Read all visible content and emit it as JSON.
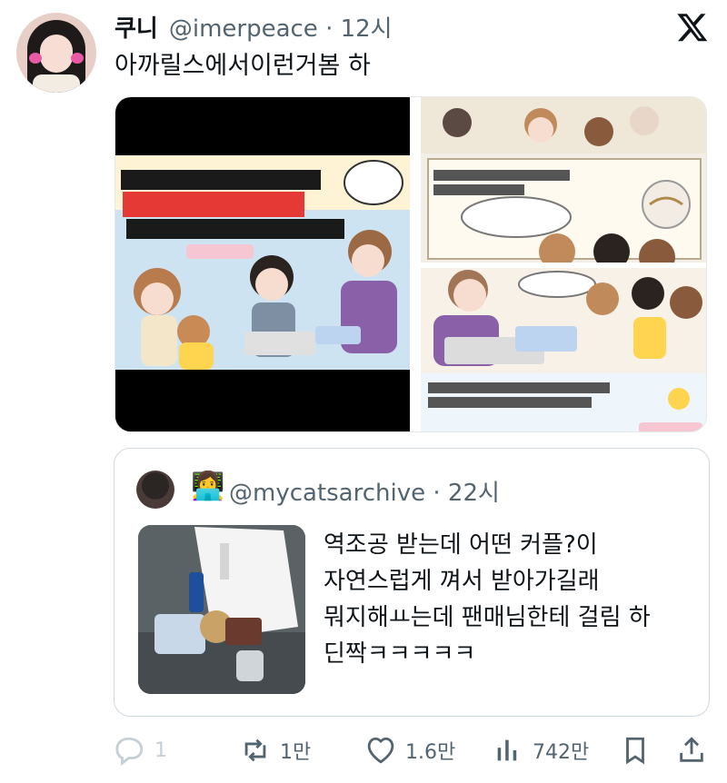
{
  "tweet": {
    "display_name": "쿠니",
    "handle": "@imerpeace · 12시",
    "text": "아까릴스에서이런거봄 하"
  },
  "quote": {
    "handle": "@mycatsarchive · 22시",
    "text": "역조공 받는데 어떤 커플?이 자연스럽게 껴서 받아가길래 뭐지해ㅛ는데 팬매님한테 걸림 하 딘짝ㅋㅋㅋㅋㅋ"
  },
  "actions": {
    "reply_count": "1",
    "retweet_count": "1만",
    "like_count": "1.6만",
    "view_count": "742만"
  },
  "icons": {
    "x_logo": "x-logo-icon",
    "reply": "reply-icon",
    "retweet": "retweet-icon",
    "like": "heart-icon",
    "views": "views-icon",
    "bookmark": "bookmark-icon",
    "share": "share-icon"
  },
  "colors": {
    "secondary_text": "#536471",
    "border": "#cfd9de"
  }
}
